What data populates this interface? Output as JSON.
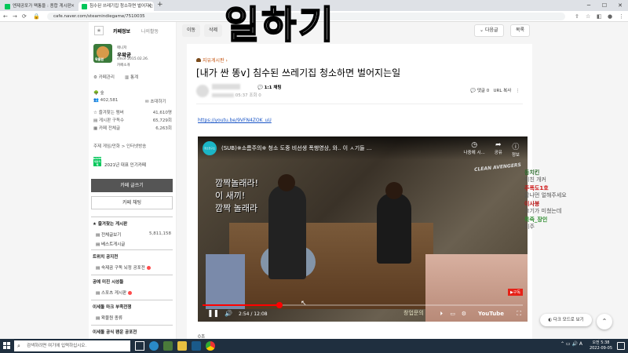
{
  "browser": {
    "tabs": [
      {
        "label": "엔제공포가 팩통을 : 종합 게시판",
        "active": false
      },
      {
        "label": "침수된 쓰레기집 청소하면 벌어지는",
        "active": true
      }
    ],
    "url": "cafe.naver.com/steamindiegame/7510035"
  },
  "overlay": {
    "title": "일하기"
  },
  "sidebar": {
    "tab_info": "카페정보",
    "tab_activity": "나의활동",
    "cafe_logo_text": "왁물원",
    "manager_label": "매니저",
    "manager_name": "우왁굳",
    "since": "since 2015.02.26.",
    "cafe_intro": "카페소개",
    "cafe_manage": "카페관리",
    "stats": "통계",
    "grade": "숲",
    "members": "402,581",
    "invite": "초대하기",
    "rows": [
      {
        "label": "즐겨찾는 멤버",
        "value": "41,610명"
      },
      {
        "label": "게시판 구독수",
        "value": "65,729회"
      },
      {
        "label": "카페 전체글",
        "value": "6,263회"
      }
    ],
    "theme_text": "주제 게임/만화 > 인터넷방송",
    "naver_badge": "NAVER 대표카페",
    "rank_text": "2021년 대표 인기카페",
    "write_btn": "카페 글쓰기",
    "chat_btn": "카페 채팅",
    "fav_header": "즐겨찾는 게시판",
    "fav_items": [
      {
        "label": "전체글보기",
        "count": "5,811,158"
      },
      {
        "label": "베스트게시글",
        "count": ""
      }
    ],
    "section1_header": "트위치 공지천",
    "section1_items": [
      {
        "label": "숙제곰 구독 뇌정 공포전"
      }
    ],
    "section2_header": "공예 미진 시성들",
    "section2_items": [
      {
        "label": "스포츠 게시판"
      }
    ],
    "section3_header": "이세돌 마크 부족전쟁",
    "section3_items": [
      {
        "label": "왁물원 종류"
      }
    ],
    "section4_header": "이세돌 공식 팬운 공포전"
  },
  "toolbar": {
    "move": "이동",
    "delete": "삭제",
    "next": "다음글",
    "list": "목록"
  },
  "post": {
    "category": "지유게시판",
    "title": "[내가 싼 똥ⅴ] 침수된 쓰레기집 청소하면 벌어지는일",
    "rank_label": "1:1 채팅",
    "time": "05:37",
    "views": "조회 0",
    "comments": "댓글 0",
    "copy_url": "URL 복사",
    "link": "https://youtu.be/9VFN4ZOK_uU"
  },
  "video": {
    "channel": "청소연구소",
    "title": "(SUB)※소름주의※ 청소 도중 비선생 폭행영상, 와.. 이 ㅅ기들 ...",
    "watch_later": "나중에 시...",
    "share": "공유",
    "info": "정보",
    "logo": "CLEAN AVENGERS",
    "subtitle_lines": [
      "깜짝놀래라!",
      "이 새끼!",
      "깜짝 놀래라"
    ],
    "subscribe": "구독",
    "time": "2:54 / 12:08",
    "progress": 0.24,
    "watermark": "창업문의",
    "youtube": "YouTube"
  },
  "footer_text": "0초",
  "chat": [
    {
      "name": "등치킨",
      "msg": "미친 개커",
      "color": "#2a6a2a"
    },
    {
      "name": "주폭도1호",
      "msg": "굴나먼 얼해주세요",
      "color": "#cc1111"
    },
    {
      "name": "이사봉",
      "msg": "크기가 미쳤는데",
      "color": "#b81414"
    },
    {
      "name": "목죽_장인",
      "msg": "이주",
      "color": "#2a8a2a"
    }
  ],
  "darkmode": "다크 모드로 보기",
  "taskbar": {
    "search_placeholder": "검색하려면 여기에 입력하십시오.",
    "clock_time": "오전 5:38",
    "clock_date": "2022-09-05",
    "ime": "A"
  }
}
